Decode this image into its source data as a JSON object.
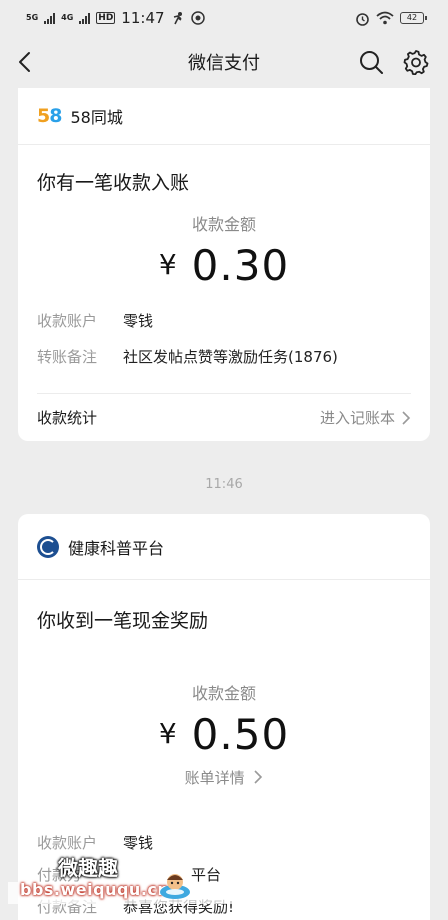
{
  "status_bar": {
    "net1": "5G",
    "net2": "4G",
    "hd": "HD",
    "time": "11:47",
    "battery": "42"
  },
  "header": {
    "title": "微信支付"
  },
  "cards": [
    {
      "merchant": "58同城",
      "logo_text": [
        "5",
        "8"
      ],
      "notice": "你有一笔收款入账",
      "amount_label": "收款金额",
      "currency": "¥",
      "amount": "0.30",
      "details": [
        {
          "key": "收款账户",
          "value": "零钱"
        },
        {
          "key": "转账备注",
          "value": "社区发帖点赞等激励任务(1876)"
        }
      ],
      "footer_left": "收款统计",
      "footer_link": "进入记账本"
    },
    {
      "merchant": "健康科普平台",
      "notice": "你收到一笔现金奖励",
      "amount_label": "收款金额",
      "currency": "¥",
      "amount": "0.50",
      "bill_link": "账单详情",
      "details": [
        {
          "key": "收款账户",
          "value": "零钱"
        },
        {
          "key": "付款方",
          "value": "平台"
        },
        {
          "key": "付款备注",
          "value": "恭喜您获得奖励!"
        }
      ]
    }
  ],
  "timestamp": "11:46",
  "watermark": {
    "cn": "微趣趣",
    "url": "bbs.weiququ.cn"
  },
  "colors": {
    "background": "#ededed",
    "card": "#ffffff",
    "secondary_text": "#8a8a8a",
    "logo_orange": "#f0a020",
    "logo_blue": "#2aa0e8",
    "health_blue": "#1d4f91"
  }
}
